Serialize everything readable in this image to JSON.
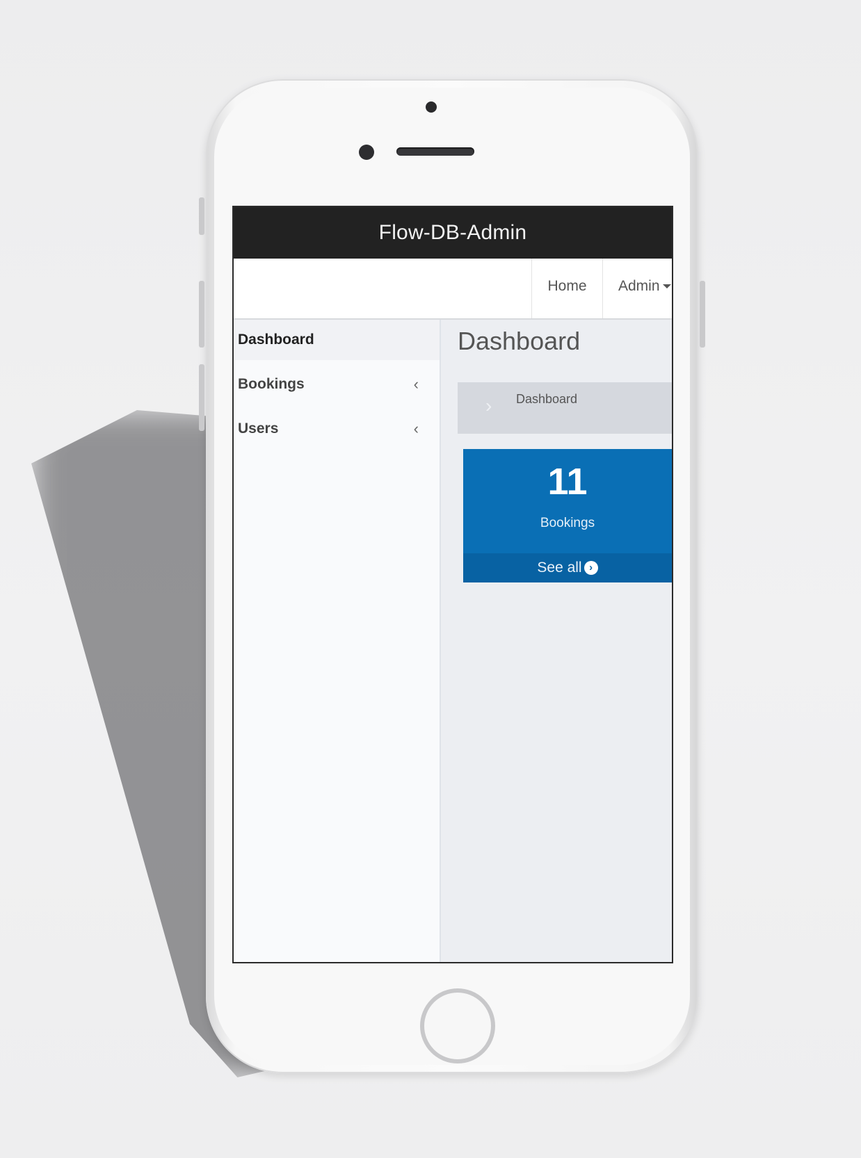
{
  "app": {
    "title": "Flow-DB-Admin"
  },
  "topnav": {
    "home": "Home",
    "admin": "Admin"
  },
  "sidebar": {
    "items": [
      {
        "label": "Dashboard",
        "active": true
      },
      {
        "label": "Bookings",
        "icon": "chevron-left-icon"
      },
      {
        "label": "Users",
        "icon": "chevron-left-icon"
      }
    ]
  },
  "main": {
    "title": "Dashboard",
    "breadcrumb": "Dashboard",
    "stat": {
      "value": "11",
      "label": "Bookings",
      "link": "See all"
    }
  },
  "colors": {
    "header_bg": "#222222",
    "stat_bg": "#0a6fb5",
    "stat_footer_bg": "#0862a3"
  }
}
